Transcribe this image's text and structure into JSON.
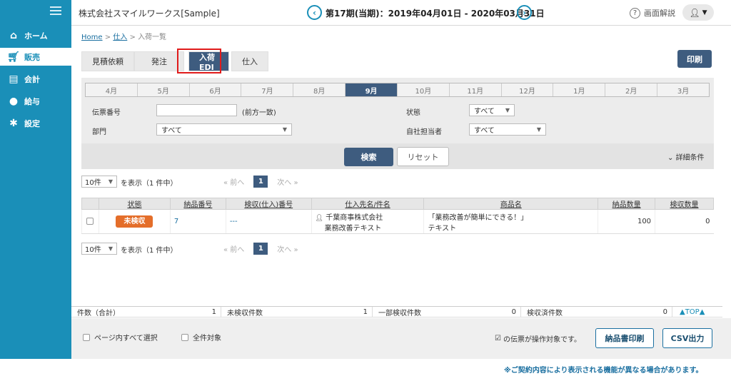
{
  "header": {
    "company": "株式会社スマイルワークス[Sample]",
    "period": "第17期(当期)：2019年04月01日 - 2020年03月31日",
    "help_label": "画面解説",
    "prev_icon": "chevron-left-circle",
    "next_icon": "chevron-right-circle"
  },
  "sidebar": {
    "items": [
      {
        "label": "ホーム",
        "icon": "home"
      },
      {
        "label": "販売",
        "icon": "cart"
      },
      {
        "label": "会計",
        "icon": "calculator"
      },
      {
        "label": "給与",
        "icon": "money-bag"
      },
      {
        "label": "設定",
        "icon": "gear"
      }
    ]
  },
  "breadcrumb": {
    "home": "Home",
    "sep1": ">",
    "purchase": "仕入",
    "sep2": ">",
    "current": "入荷一覧"
  },
  "tabs": [
    "見積依頼",
    "発注",
    "入荷EDI",
    "仕入"
  ],
  "print_label": "印刷",
  "months": [
    "4月",
    "5月",
    "6月",
    "7月",
    "8月",
    "9月",
    "10月",
    "11月",
    "12月",
    "1月",
    "2月",
    "3月"
  ],
  "filters": {
    "slip_no_label": "伝票番号",
    "slip_no_value": "",
    "slip_no_hint": "(前方一致)",
    "dept_label": "部門",
    "dept_value": "すべて",
    "state_label": "状態",
    "state_value": "すべて",
    "staff_label": "自社担当者",
    "staff_value": "すべて"
  },
  "search_label": "検索",
  "reset_label": "リセット",
  "detail_label": "詳細条件",
  "pagination": {
    "per_page": "10件",
    "display_text": "を表示（1 件中）",
    "prev": "«  前へ",
    "page": "1",
    "next": "次へ  »"
  },
  "table": {
    "headers": [
      "状態",
      "納品番号",
      "検収(仕入)番号",
      "仕入先名/件名",
      "商品名",
      "納品数量",
      "検収数量"
    ],
    "rows": [
      {
        "status": "未検収",
        "delivery_no": "7",
        "receipt_no": "---",
        "supplier": "千葉商事株式会社",
        "subject": "業務改善テキスト",
        "product_line1": "「業務改善が簡単にできる！」",
        "product_line2": "テキスト",
        "delivered_qty": "100",
        "received_qty": "0"
      }
    ]
  },
  "summary": {
    "total_label": "件数（合計）",
    "total_value": "1",
    "unchecked_label": "未検収件数",
    "unchecked_value": "1",
    "partial_label": "一部検収件数",
    "partial_value": "0",
    "checked_label": "検収済件数",
    "checked_value": "0",
    "top_label": "▲TOP▲"
  },
  "bottom": {
    "select_page_label": "ページ内すべて選択",
    "select_all_label": "全件対象",
    "op_note": "の伝票が操作対象です。",
    "delivery_print_label": "納品書印刷",
    "csv_label": "CSV出力"
  },
  "footnote": "※ご契約内容により表示される機能が異なる場合があります。",
  "colors": {
    "sidebar": "#1a8fb8",
    "primary_button": "#3e5c7f",
    "status_badge": "#e46e2a",
    "highlight": "#e01b1b"
  }
}
